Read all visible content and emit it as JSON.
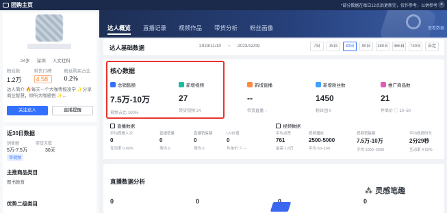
{
  "topbar": {
    "brand": "团购主页",
    "notice": "*部分数据在每日12点后更新完，仅作参考，以供参考",
    "close": "×"
  },
  "tabs": [
    {
      "label": "达人概览",
      "active": true
    },
    {
      "label": "直播记录",
      "active": false
    },
    {
      "label": "视频作品",
      "active": false
    },
    {
      "label": "带货分析",
      "active": false
    },
    {
      "label": "粉丝画像",
      "active": false
    }
  ],
  "header_more": "查看数据",
  "profile": {
    "age": "24岁",
    "city": "深圳",
    "type": "人文社科",
    "stats": [
      {
        "label": "粉丝数",
        "value": "1.2万"
      },
      {
        "label": "带货口碑",
        "value": "4.58"
      },
      {
        "label": "粉丝购买占比",
        "value": "0.2%"
      }
    ],
    "intro": "达人简介 🔥每天一个大咖传授凌学 ✨分享商业智慧，倾听大咖感悟 ✨…",
    "follow_btn": "关注达人",
    "live_btn": "直播提醒"
  },
  "recent30": {
    "title": "近30日数据",
    "labels": [
      "销售额",
      "带货天数"
    ],
    "values": [
      "5万-7.5万",
      "30天"
    ],
    "tag": "带视频",
    "main_cat_title": "主推商品类目",
    "main_cat_value": "图书教育",
    "secondary_cat_title": "优势二级类目"
  },
  "basic": {
    "title": "达人基础数据",
    "date_start": "2023/11/10",
    "date_sep": "~",
    "date_end": "2023/12/09",
    "ranges": [
      {
        "label": "7日",
        "selected": false
      },
      {
        "label": "15日",
        "selected": false
      },
      {
        "label": "30日",
        "selected": true
      },
      {
        "label": "90日",
        "selected": false
      },
      {
        "label": "180日",
        "selected": false
      },
      {
        "label": "365日",
        "selected": false
      },
      {
        "label": "730日",
        "selected": false
      },
      {
        "label": "自定",
        "selected": false
      }
    ]
  },
  "core": {
    "title": "核心数据",
    "metrics": [
      {
        "label": "总销售额",
        "value": "7.5万-10万",
        "sub": "视频占比 100%",
        "color": "#3370ff",
        "icon": "sales-icon"
      },
      {
        "label": "新增视频",
        "value": "27",
        "sub": "带货视频 24",
        "color": "#14c0a0",
        "icon": "video-icon"
      },
      {
        "label": "新增直播",
        "value": "--",
        "sub": "带货直播 --",
        "color": "#ff8a3d",
        "icon": "live-icon"
      },
      {
        "label": "新增粉丝数",
        "value": "1450",
        "sub": "粉丝团 0",
        "color": "#3fa2ff",
        "icon": "fans-icon"
      },
      {
        "label": "推广商品数",
        "value": "21",
        "sub": "件单价 ⓘ 10–50",
        "color": "#e15db5",
        "icon": "product-icon"
      }
    ]
  },
  "live_section": {
    "title": "直播数据",
    "cols": [
      {
        "label": "平均观看人次",
        "value": "0",
        "sub": "互动率 0.00%"
      },
      {
        "label": "直播销量",
        "value": "0",
        "sub": "场均 0"
      },
      {
        "label": "直播销售额",
        "value": "0",
        "sub": "场均 0"
      },
      {
        "label": "UV价值",
        "value": "0",
        "sub": "件单价 ⓘ --"
      }
    ]
  },
  "video_section": {
    "title": "视频数据",
    "cols": [
      {
        "label": "平均点赞",
        "value": "761",
        "sub": "最高 1.8万"
      },
      {
        "label": "视频播放",
        "value": "2500-5000",
        "sub": "平均 50–100"
      },
      {
        "label": "视频销售额",
        "value": "7.5万-10万",
        "sub": "平均 1000–2500"
      },
      {
        "label": "平均视频时长",
        "value": "2分29秒",
        "sub": "互动率 4.62%"
      }
    ]
  },
  "analysis": {
    "title": "直播数据分析",
    "zeros": [
      "0",
      "0",
      "0",
      "0"
    ]
  },
  "watermark": "灵感笔趣"
}
